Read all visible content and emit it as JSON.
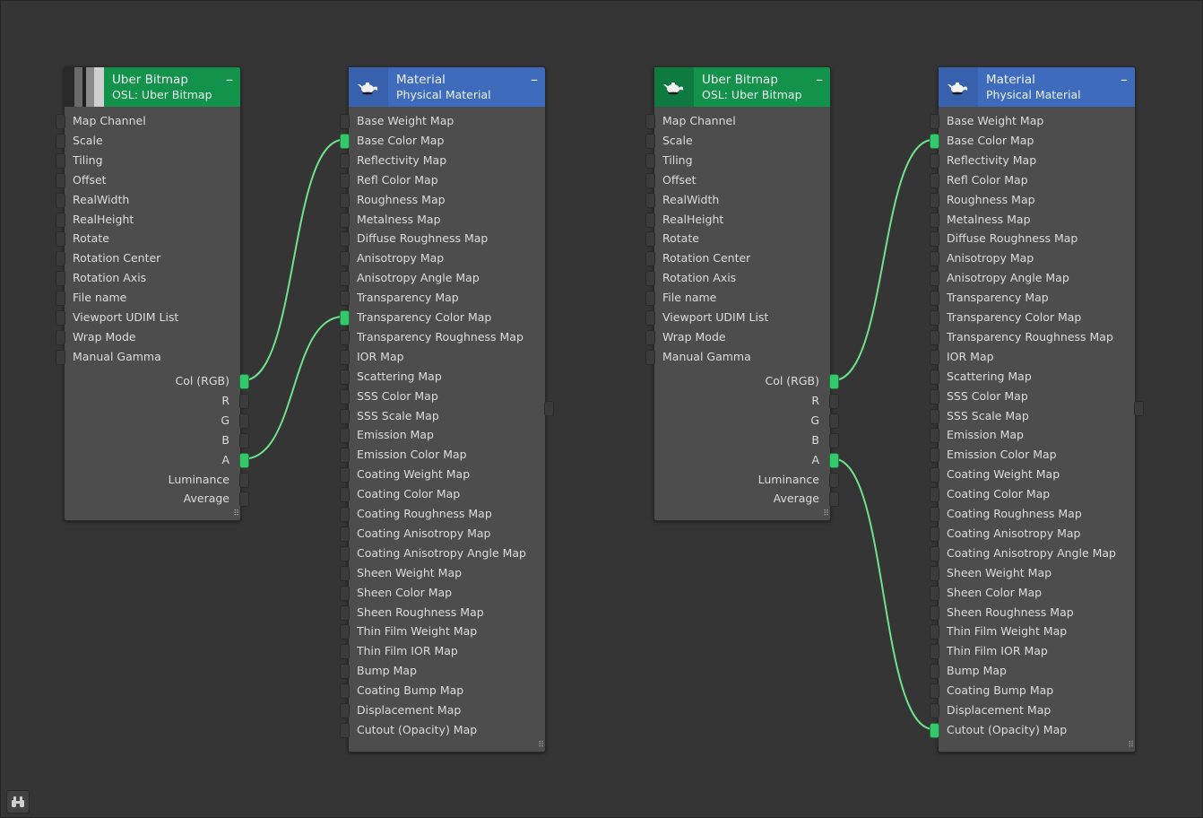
{
  "colors": {
    "canvas_bg": "#353535",
    "node_bg": "#4d4d4d",
    "osl_header": "#13924c",
    "material_header": "#3f6bbd",
    "connected_socket": "#35c86b",
    "wire": "#6fe08e"
  },
  "nodes": {
    "bitmap1": {
      "title": "Uber Bitmap",
      "subtitle": "OSL: Uber Bitmap",
      "minimize": "–"
    },
    "material1": {
      "title": "Material",
      "subtitle": "Physical Material",
      "minimize": "–"
    },
    "bitmap2": {
      "title": "Uber Bitmap",
      "subtitle": "OSL: Uber Bitmap",
      "minimize": "–"
    },
    "material2": {
      "title": "Material",
      "subtitle": "Physical Material",
      "minimize": "–"
    }
  },
  "bitmap_inputs": [
    "Map Channel",
    "Scale",
    "Tiling",
    "Offset",
    "RealWidth",
    "RealHeight",
    "Rotate",
    "Rotation Center",
    "Rotation Axis",
    "File name",
    "Viewport UDIM List",
    "Wrap Mode",
    "Manual Gamma"
  ],
  "bitmap_outputs": [
    "Col (RGB)",
    "R",
    "G",
    "B",
    "A",
    "Luminance",
    "Average"
  ],
  "material_inputs": [
    "Base Weight Map",
    "Base Color Map",
    "Reflectivity Map",
    "Refl Color Map",
    "Roughness Map",
    "Metalness Map",
    "Diffuse Roughness Map",
    "Anisotropy Map",
    "Anisotropy Angle Map",
    "Transparency Map",
    "Transparency Color Map",
    "Transparency Roughness Map",
    "IOR Map",
    "Scattering Map",
    "SSS Color Map",
    "SSS Scale Map",
    "Emission Map",
    "Emission Color Map",
    "Coating Weight Map",
    "Coating Color Map",
    "Coating Roughness Map",
    "Coating Anisotropy Map",
    "Coating Anisotropy Angle Map",
    "Sheen Weight Map",
    "Sheen Color Map",
    "Sheen Roughness Map",
    "Thin Film Weight Map",
    "Thin Film IOR Map",
    "Bump Map",
    "Coating Bump Map",
    "Displacement Map",
    "Cutout (Opacity) Map"
  ],
  "connections": [
    {
      "from": "bitmap1.Col (RGB)",
      "to": "material1.Base Color Map"
    },
    {
      "from": "bitmap1.A",
      "to": "material1.Transparency Color Map"
    },
    {
      "from": "bitmap2.Col (RGB)",
      "to": "material2.Base Color Map"
    },
    {
      "from": "bitmap2.A",
      "to": "material2.Cutout (Opacity) Map"
    }
  ],
  "icons": {
    "bitmap_thumbnail": "bitmap-thumbnail-icon",
    "teapot": "teapot-icon",
    "bottom_tool": "binoculars-icon"
  }
}
